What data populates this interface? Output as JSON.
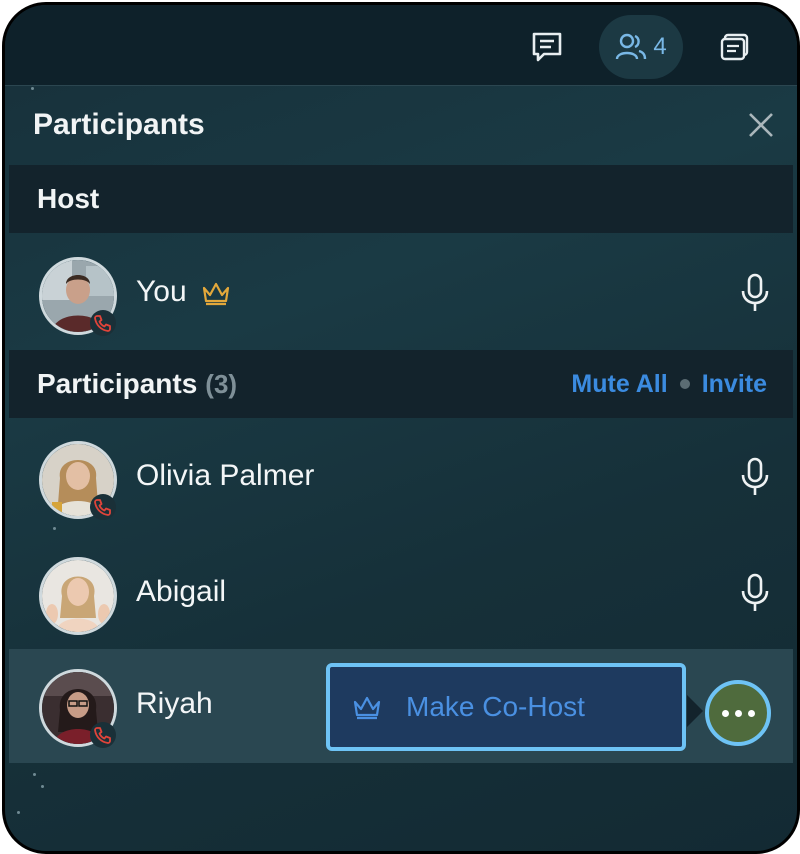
{
  "topbar": {
    "chat_icon": "chat-icon",
    "people_icon": "people-icon",
    "people_count": "4",
    "layers_icon": "layers-icon",
    "accent": "#79b8e6"
  },
  "panel": {
    "title": "Participants",
    "close_icon": "close-icon"
  },
  "host_section": {
    "label": "Host"
  },
  "host": {
    "name": "You",
    "crown_icon": "crown-icon",
    "crown_color": "#e3a83b",
    "mic_icon": "mic-icon"
  },
  "participants_section": {
    "label": "Participants",
    "count": "(3)",
    "mute_all": "Mute All",
    "invite": "Invite",
    "link_color": "#3b8be0"
  },
  "participants": [
    {
      "name": "Olivia Palmer",
      "on_call": true
    },
    {
      "name": "Abigail",
      "on_call": false
    },
    {
      "name": "Riyah",
      "on_call": true
    }
  ],
  "menu": {
    "make_cohost": "Make Co-Host",
    "crown_icon": "crown-icon",
    "more_icon": "more-icon"
  }
}
